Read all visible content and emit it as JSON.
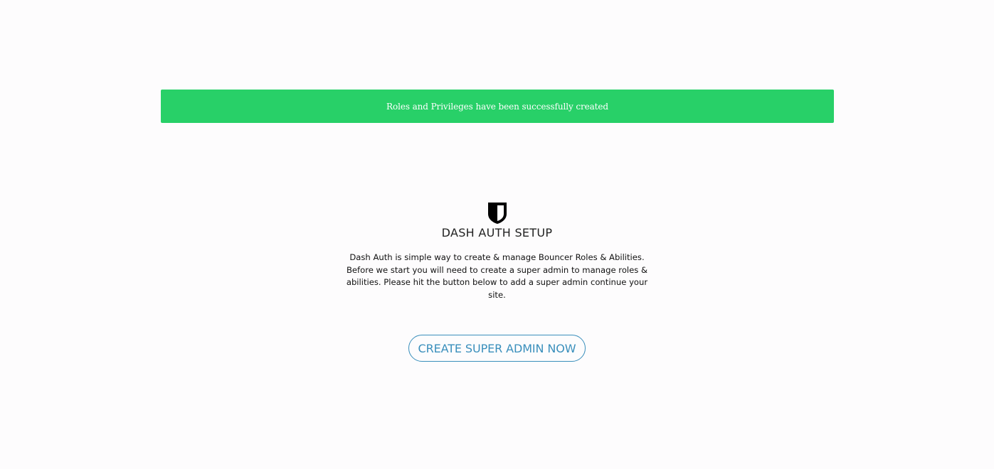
{
  "alert": {
    "message": "Roles and Privileges have been successfully created",
    "color": "#28d068"
  },
  "setup": {
    "logo_icon": "shield-icon",
    "title": "DASH AUTH SETUP",
    "description": "Dash Auth is simple way to create & manage Bouncer Roles & Abilities. Before we start you will need to create a super admin to manage roles & abilities. Please hit the button below to add a super admin continue your site.",
    "button_label": "CREATE SUPER ADMIN NOW",
    "accent_color": "#3a8fbc"
  }
}
